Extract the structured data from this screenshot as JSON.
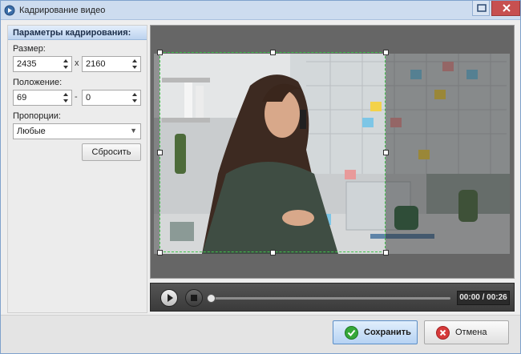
{
  "window": {
    "title": "Кадрирование видео"
  },
  "panel": {
    "header": "Параметры кадрирования:",
    "size_label": "Размер:",
    "width": "2435",
    "size_sep": "x",
    "height": "2160",
    "position_label": "Положение:",
    "pos_x": "69",
    "pos_sep": "-",
    "pos_y": "0",
    "proportions_label": "Пропорции:",
    "proportions_value": "Любые",
    "reset_label": "Сбросить"
  },
  "player": {
    "time": "00:00 / 00:26",
    "progress": 0
  },
  "actions": {
    "save_label": "Сохранить",
    "cancel_label": "Отмена"
  },
  "colors": {
    "accent": "#3fc24a",
    "save_icon": "#35a83a",
    "cancel_icon": "#d63a3a"
  },
  "icons": {
    "app": "app-icon",
    "play": "play-icon",
    "stop": "stop-icon",
    "save": "checkmark-icon",
    "cancel": "close-icon"
  }
}
